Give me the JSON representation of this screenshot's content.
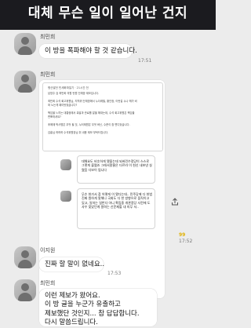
{
  "banner": {
    "headline": "대체 무슨 일이 일어난 건지"
  },
  "messages": [
    {
      "sender": "최민희",
      "text": "이 방을 폭파해야 할 것 같습니다.",
      "time": "17:51"
    },
    {
      "sender": "최민희",
      "time": "17:52",
      "doc": {
        "source": "평산발언 민세화파일기 · 21시간 전",
        "lines": [
          "남영주 검 최민희 의원 탄원 단체방 제보입니다.",
          "",
          "최민희 수석 회고위원님, 지역위 단체방에서 누더레필, 황인정, 이런걸 누나 헤가 비",
          "와 노는게 페이탔었습니다?",
          "",
          "책임을 느끼는 대통령에서 촉발과 관료를 말을 해대는데, 수석 회고위원은 책임을",
          "면뽀하셔요?",
          "",
          "후에때 박사명은 무엇 될 것, 누터제원은 무엇 버닌, 수준이 참 면디었습니다.",
          "",
          "김홍님 하하하 수석위원장님 취 내용 제보 부탁드립니다."
        ]
      },
      "cards": [
        {
          "text": "대해요도 비슷하게 됐을는데 되버린수정당이 스스로 그렇게 불렸죠 그래서말줄은 더르라 이 헌신 내보낸 실렸음 다보이 됩니다",
          "footer": ""
        },
        {
          "text": "무슨 헌가서 참 어떻게 이 됐다는데.. 민주당에 다 헌법진짜 원하게 말해나 국회도 다 한 방향으로 움직이고 있고, 일하는 일반다 아니 확립중 개관정당 사전에 도 사우 맞았던게 말하는 신문제할 내 미무 서..",
          "footer": ""
        }
      ],
      "unread": "99",
      "card_time": "17:52"
    },
    {
      "sender": "이지원",
      "text": "진짜 할 말이 없네요..",
      "time": "17:53"
    },
    {
      "sender": "최민희",
      "text_lines": [
        "이런 제보가 왔어요.",
        "이 방 글을 누군가 유출하고",
        "제보했단 것인지... 참 답답합니다.",
        "다시 말씀드립니다."
      ]
    }
  ]
}
